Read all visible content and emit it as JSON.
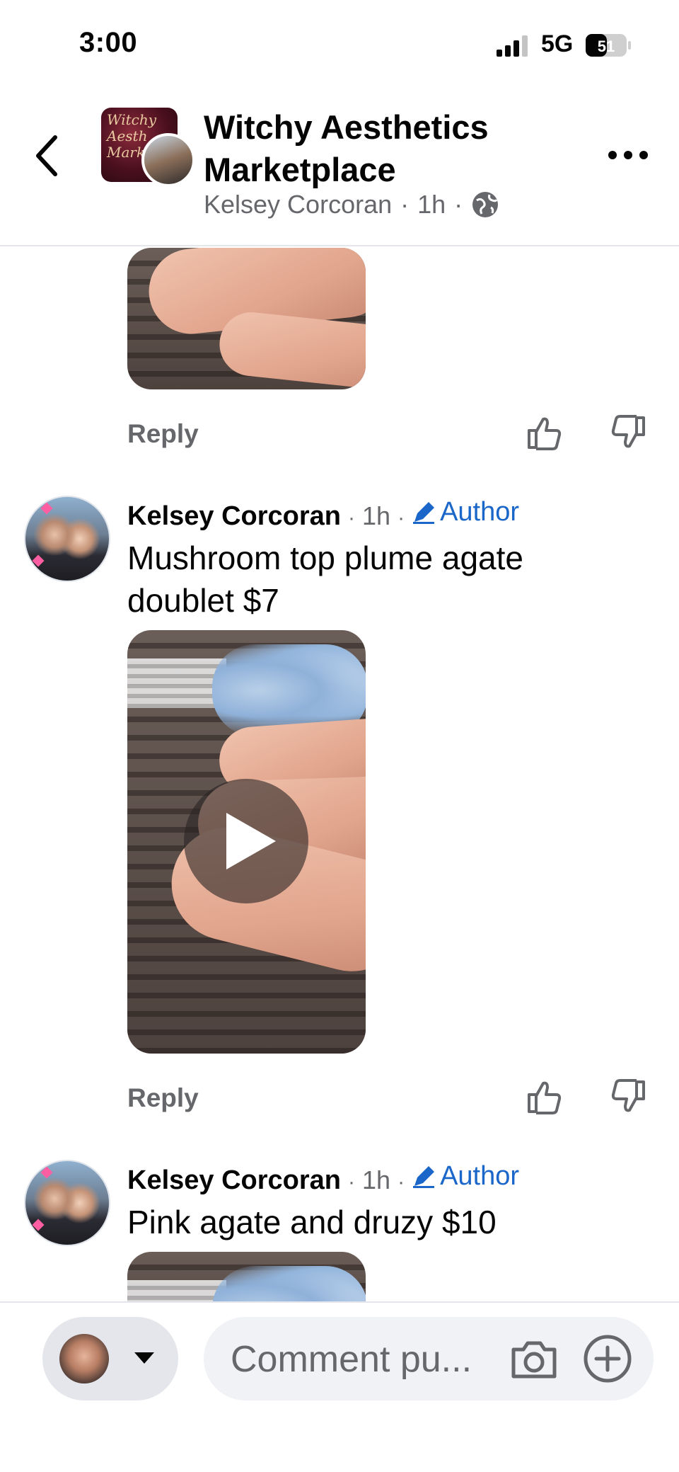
{
  "status_bar": {
    "time": "3:00",
    "network": "5G",
    "battery": "51"
  },
  "header": {
    "title": "Witchy Aesthetics Marketplace",
    "author": "Kelsey Corcoran",
    "time": "1h",
    "group_avatar_text": "Witchy Aesthetics Marketplace"
  },
  "comments": [
    {
      "name": "Kelsey Corcoran",
      "time": "1h",
      "badge": "Author",
      "text": "Mushroom top plume agate doublet $7",
      "media": "video",
      "reply": "Reply"
    },
    {
      "name": "Kelsey Corcoran",
      "time": "1h",
      "badge": "Author",
      "text": "Pink agate and druzy $10",
      "media": "image"
    }
  ],
  "previous_comment": {
    "reply": "Reply"
  },
  "composer": {
    "placeholder": "Comment pu..."
  },
  "colors": {
    "author_blue": "#1a66c9",
    "secondary_text": "#65676b",
    "divider": "#e4e6eb"
  }
}
